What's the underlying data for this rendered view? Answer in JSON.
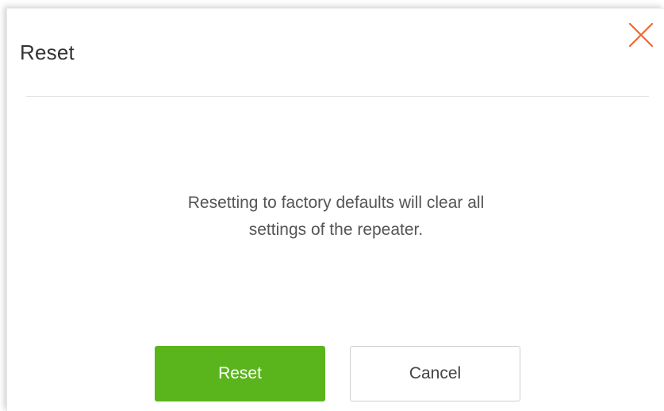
{
  "dialog": {
    "title": "Reset",
    "close_icon": "close-icon",
    "message_line1": "Resetting to factory defaults will clear all",
    "message_line2": "settings of the repeater.",
    "reset_label": "Reset",
    "cancel_label": "Cancel"
  },
  "colors": {
    "accent_green": "#5ab51c",
    "close_orange": "#f0652f",
    "text": "#555555"
  }
}
